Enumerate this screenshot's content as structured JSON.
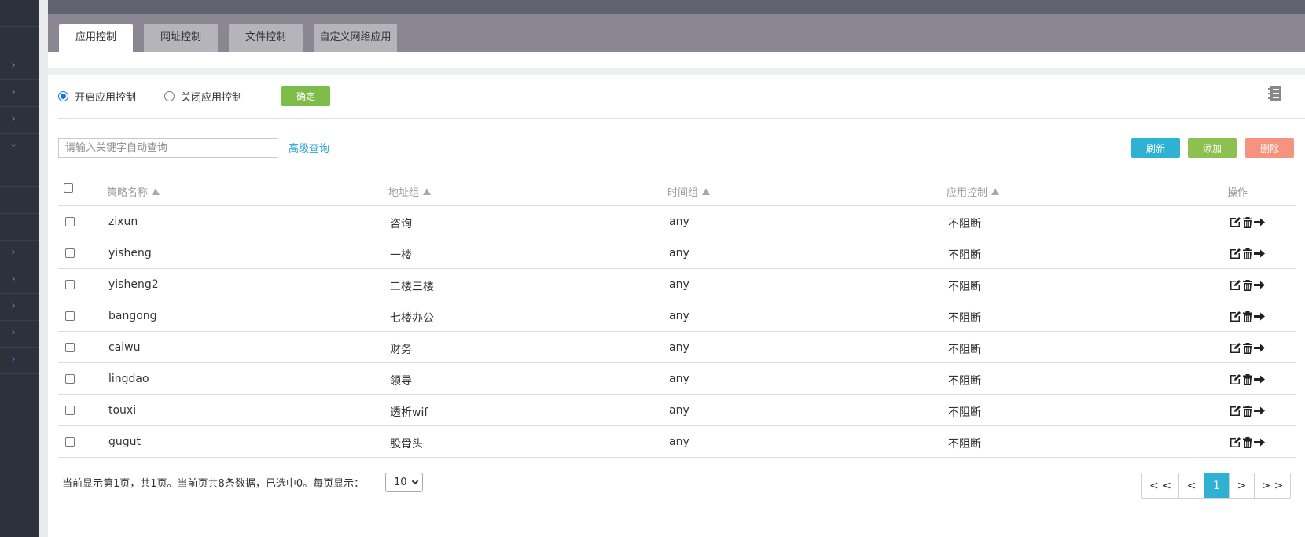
{
  "tabs": [
    {
      "label": "应用控制",
      "active": true
    },
    {
      "label": "网址控制",
      "active": false
    },
    {
      "label": "文件控制",
      "active": false
    },
    {
      "label": "自定义网络应用",
      "active": false
    }
  ],
  "control": {
    "enable_label": "开启应用控制",
    "disable_label": "关闭应用控制",
    "selected": "enable",
    "confirm_label": "确定"
  },
  "toolbar": {
    "search_placeholder": "请输入关键字自动查询",
    "advanced_search_label": "高级查询",
    "refresh_label": "刷新",
    "add_label": "添加",
    "delete_label": "删除"
  },
  "table": {
    "columns": [
      "策略名称",
      "地址组",
      "时间组",
      "应用控制",
      "操作"
    ],
    "rows": [
      {
        "name": "zixun",
        "address_group": "咨询",
        "time_group": "any",
        "app_control": "不阻断"
      },
      {
        "name": "yisheng",
        "address_group": "一楼",
        "time_group": "any",
        "app_control": "不阻断"
      },
      {
        "name": "yisheng2",
        "address_group": "二楼三楼",
        "time_group": "any",
        "app_control": "不阻断"
      },
      {
        "name": "bangong",
        "address_group": "七楼办公",
        "time_group": "any",
        "app_control": "不阻断"
      },
      {
        "name": "caiwu",
        "address_group": "财务",
        "time_group": "any",
        "app_control": "不阻断"
      },
      {
        "name": "lingdao",
        "address_group": "领导",
        "time_group": "any",
        "app_control": "不阻断"
      },
      {
        "name": "touxi",
        "address_group": "透析wif",
        "time_group": "any",
        "app_control": "不阻断"
      },
      {
        "name": "gugut",
        "address_group": "股骨头",
        "time_group": "any",
        "app_control": "不阻断"
      }
    ]
  },
  "footer": {
    "summary": "当前显示第1页，共1页。当前页共8条数据，已选中0。每页显示：",
    "per_page": "10"
  },
  "pagination": {
    "first": "< <",
    "prev": "<",
    "current": "1",
    "next": ">",
    "last": "> >"
  },
  "sidebar": {
    "chevrons": [
      ">",
      ">",
      ">",
      "v",
      ">",
      ">",
      ">",
      ">",
      ">"
    ]
  },
  "colors": {
    "refresh": "#2fb1d4",
    "add": "#8cc04f",
    "delete": "#f5937e",
    "confirm": "#7cbc48",
    "link": "#2ea0d6",
    "sidebar": "#2c313c"
  },
  "icons": [
    "edit-icon",
    "trash-icon",
    "move-arrow-icon",
    "note-icon",
    "sort-up-icon"
  ]
}
